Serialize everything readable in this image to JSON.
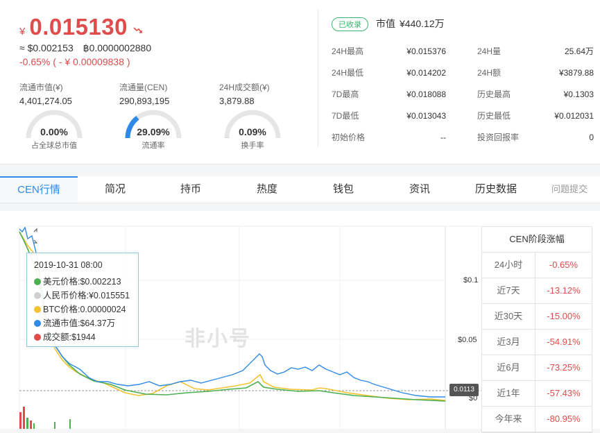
{
  "header": {
    "currency_symbol": "¥",
    "price": "0.015130",
    "trend_icon": "trend-down-icon",
    "usd_price": "≈ $0.002153",
    "btc_price": "฿0.0000002880",
    "change": "-0.65%  ( - ¥ 0.00009838 )"
  },
  "stats": [
    {
      "label": "流通市值(¥)",
      "value": "4,401,274.05"
    },
    {
      "label": "流通量(CEN)",
      "value": "290,893,195"
    },
    {
      "label": "24H成交额(¥)",
      "value": "3,879.88"
    }
  ],
  "gauges": [
    {
      "percent": "0.00%",
      "label": "占全球总市值",
      "fraction": 0.0
    },
    {
      "percent": "29.09%",
      "label": "流通率",
      "fraction": 0.2909
    },
    {
      "percent": "0.09%",
      "label": "换手率",
      "fraction": 0.0009
    }
  ],
  "market": {
    "badge": "已收录",
    "cap_label": "市值",
    "cap_value": "¥440.12万",
    "rows": [
      {
        "k1": "24H最高",
        "v1": "¥0.015376",
        "k2": "24H量",
        "v2": "25.64万"
      },
      {
        "k1": "24H最低",
        "v1": "¥0.014202",
        "k2": "24H额",
        "v2": "¥3879.88"
      },
      {
        "k1": "7D最高",
        "v1": "¥0.018088",
        "k2": "历史最高",
        "v2": "¥0.1303"
      },
      {
        "k1": "7D最低",
        "v1": "¥0.013043",
        "k2": "历史最低",
        "v2": "¥0.012031"
      },
      {
        "k1": "初始价格",
        "v1": "--",
        "k2": "投资回报率",
        "v2": "0"
      }
    ]
  },
  "tabs": [
    "CEN行情",
    "简况",
    "持币",
    "热度",
    "钱包",
    "资讯",
    "历史数据",
    "问题提交"
  ],
  "tooltip": {
    "date": "2019-10-31 08:00",
    "items": [
      {
        "color": "#4caf50",
        "text": "美元价格:$0.002213"
      },
      {
        "color": "#d0d0d0",
        "text": "人民币价格:¥0.015551"
      },
      {
        "color": "#f2c230",
        "text": "BTC价格:0.00000024"
      },
      {
        "color": "#2e8ae6",
        "text": "流通市值:$64.37万"
      },
      {
        "color": "#e04b4b",
        "text": "成交额:$1944"
      }
    ]
  },
  "chart_axis": {
    "y1": "$0.1",
    "y2": "$0.05",
    "y3": "$0",
    "current": "0.0113"
  },
  "watermark": "非小号",
  "sidebar": {
    "title": "CEN阶段涨幅",
    "rows": [
      {
        "period": "24小时",
        "change": "-0.65%"
      },
      {
        "period": "近7天",
        "change": "-13.12%"
      },
      {
        "period": "近30天",
        "change": "-15.00%"
      },
      {
        "period": "近3月",
        "change": "-54.91%"
      },
      {
        "period": "近6月",
        "change": "-73.25%"
      },
      {
        "period": "近1年",
        "change": "-57.43%"
      },
      {
        "period": "今年来",
        "change": "-80.95%"
      }
    ]
  },
  "colors": {
    "up_down": "#e04b4b",
    "accent": "#2e8ae6",
    "badge": "#3fb46c"
  }
}
